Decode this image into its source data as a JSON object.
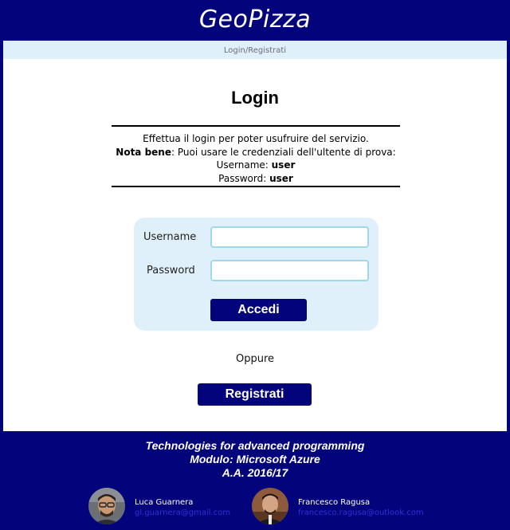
{
  "header": {
    "logo": "GeoPizza"
  },
  "breadcrumb": {
    "text": "Login/Registrati"
  },
  "main": {
    "title": "Login",
    "notice": {
      "line1": "Effettua il login per poter usufruire del servizio.",
      "nota_label": "Nota bene",
      "nota_text": ": Puoi usare le credenziali dell'ultente di prova:",
      "username_label": "Username: ",
      "username_value": "user",
      "password_label": "Password: ",
      "password_value": "user"
    },
    "login_form": {
      "username_label": "Username",
      "username_value": "",
      "password_label": "Password",
      "password_value": "",
      "submit_label": "Accedi"
    },
    "or_text": "Oppure",
    "register_label": "Registrati"
  },
  "footer": {
    "line1": "Technologies for advanced programming",
    "line2": "Modulo: Microsoft Azure",
    "line3": "A.A. 2016/17",
    "authors": [
      {
        "name": "Luca Guarnera",
        "email": "gl.guarnera@gmail.com"
      },
      {
        "name": "Francesco Ragusa",
        "email": "francesco.ragusa@outlook.com"
      }
    ]
  },
  "colors": {
    "brand_navy": "#03037b",
    "light_blue_panel": "#e0f0fb",
    "input_border": "#9fd8ea",
    "link_blue": "#3030d8"
  }
}
